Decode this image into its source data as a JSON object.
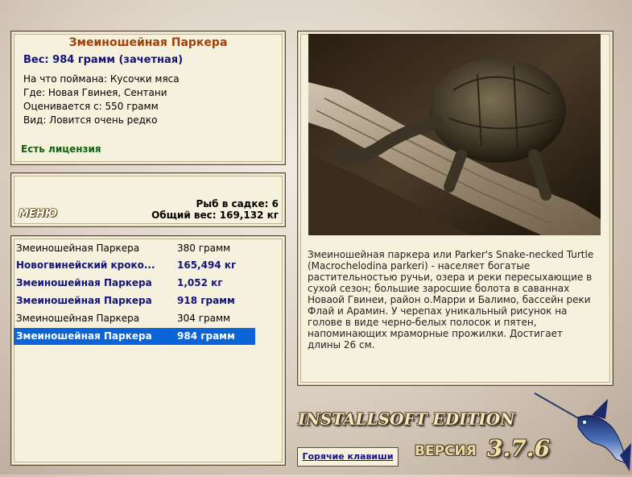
{
  "fish_info": {
    "title": "Змеиношейная Паркера",
    "weight": "Вес: 984 грамм (зачетная)",
    "caught_on": "На что поймана: Кусочки мяса",
    "where": "Где: Новая Гвинея, Сентани",
    "rated_from": "Оценивается с: 550 грамм",
    "kind": "Вид: Ловится очень редко",
    "license": "Есть лицензия"
  },
  "cage": {
    "menu_label": "МЕНЮ",
    "fish_in_cage": "Рыб в садке: 6",
    "total_weight": "Общий вес: 169,132 кг"
  },
  "catch_list": [
    {
      "name": "Змеиношейная Паркера",
      "weight": "380 грамм",
      "style": "normal"
    },
    {
      "name": "Новогвинейский кроко...",
      "weight": "165,494 кг",
      "style": "bold"
    },
    {
      "name": "Змеиношейная Паркера",
      "weight": "1,052 кг",
      "style": "bold"
    },
    {
      "name": "Змеиношейная Паркера",
      "weight": "918 грамм",
      "style": "bold"
    },
    {
      "name": "Змеиношейная Паркера",
      "weight": "304 грамм",
      "style": "normal"
    },
    {
      "name": "Змеиношейная Паркера",
      "weight": "984 грамм",
      "style": "selected"
    }
  ],
  "description": "Змеиношейная паркера или Parker's Snake-necked Turtle (Macrochelodina parkeri) - населяет богатые растительностью ручьи, озера и реки пересыхающие в сухой сезон; большие заросшие болота в саваннах Новаой Гвинеи, район о.Марри и Балимо, бассейн реки Флай и Арамин. У черепах уникальный рисунок на голове в виде черно-белых полосок и пятен, напоминающих мраморные прожилки. Достигает длины 26 см.",
  "hotkeys_label": "Горячие клавиши",
  "branding": {
    "edition": "INSTALLSOFT EDITION",
    "version_label": "ВЕРСИЯ",
    "version_number": "3.7.6"
  },
  "colors": {
    "selection": "#0a64d8",
    "title": "#a0400a",
    "bold_rows": "#14147a",
    "license": "#106010"
  }
}
